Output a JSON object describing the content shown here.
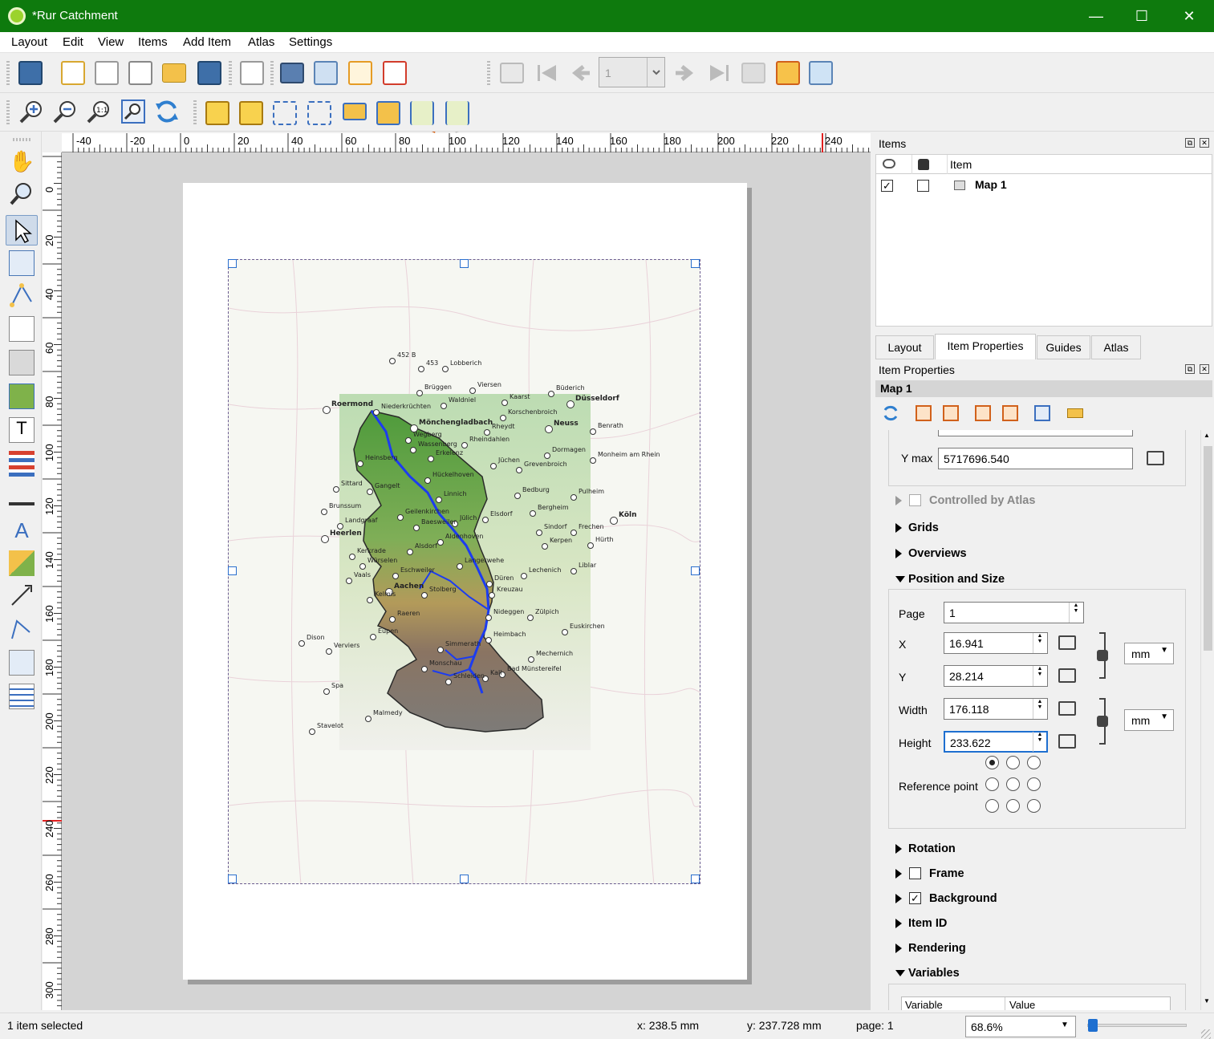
{
  "window": {
    "title": "*Rur Catchment",
    "controls": {
      "minimize": "—",
      "maximize": "☐",
      "close": "✕"
    }
  },
  "menu": [
    "Layout",
    "Edit",
    "View",
    "Items",
    "Add Item",
    "Atlas",
    "Settings"
  ],
  "toolbar": {
    "page_number": "1"
  },
  "ruler": {
    "top_labels": [
      "-40",
      "-20",
      "0",
      "20",
      "40",
      "60",
      "80",
      "100",
      "120",
      "140",
      "160",
      "180",
      "200",
      "220",
      "240"
    ],
    "left_labels": [
      "0",
      "20",
      "40",
      "60",
      "80",
      "100",
      "120",
      "140",
      "160",
      "180",
      "200",
      "220",
      "240",
      "260",
      "280",
      "300"
    ]
  },
  "items_panel": {
    "title": "Items",
    "column_item": "Item",
    "rows": [
      {
        "visible": true,
        "locked": false,
        "name": "Map 1"
      }
    ]
  },
  "tabs": [
    "Layout",
    "Item Properties",
    "Guides",
    "Atlas"
  ],
  "active_tab": "Item Properties",
  "item_properties": {
    "panel_title": "Item Properties",
    "item_name": "Map 1",
    "y_max_label": "Y max",
    "y_max_value": "5717696.540",
    "controlled_by_atlas": "Controlled by Atlas",
    "sections": {
      "grids": "Grids",
      "overviews": "Overviews",
      "position_and_size": "Position and Size",
      "rotation": "Rotation",
      "frame": "Frame",
      "background": "Background",
      "item_id": "Item ID",
      "rendering": "Rendering",
      "variables": "Variables"
    },
    "position": {
      "page_label": "Page",
      "page_value": "1",
      "x_label": "X",
      "x_value": "16.941",
      "y_label": "Y",
      "y_value": "28.214",
      "width_label": "Width",
      "width_value": "176.118",
      "height_label": "Height",
      "height_value": "233.622",
      "unit_position": "mm",
      "unit_size": "mm",
      "reference_point_label": "Reference point"
    },
    "frame_checked": false,
    "background_checked": true,
    "variables_table": {
      "col1": "Variable",
      "col2": "Value"
    }
  },
  "map": {
    "places": [
      {
        "name": "Roermond",
        "bold": true
      },
      {
        "name": "Niederkrüchten"
      },
      {
        "name": "Mönchengladbach",
        "bold": true
      },
      {
        "name": "Düsseldorf",
        "bold": true
      },
      {
        "name": "Neuss",
        "bold": true
      },
      {
        "name": "Heerlen",
        "bold": true
      },
      {
        "name": "Aachen",
        "bold": true
      },
      {
        "name": "Köln",
        "bold": true
      },
      {
        "name": "Jülich"
      },
      {
        "name": "Düren"
      },
      {
        "name": "Monschau"
      },
      {
        "name": "Schleiden"
      },
      {
        "name": "Stolberg"
      },
      {
        "name": "Kerpen"
      },
      {
        "name": "Zülpich"
      },
      {
        "name": "Euskirchen"
      },
      {
        "name": "Malmedy"
      },
      {
        "name": "Linnich"
      },
      {
        "name": "Hückelhoven"
      },
      {
        "name": "Erkelenz"
      },
      {
        "name": "Heinsberg"
      },
      {
        "name": "Geilenkirchen"
      },
      {
        "name": "Eschweiler"
      },
      {
        "name": "Alsdorf"
      },
      {
        "name": "Baesweiler"
      },
      {
        "name": "Langerwehe"
      },
      {
        "name": "Kreuzau"
      },
      {
        "name": "Nideggen"
      },
      {
        "name": "Heimbach"
      },
      {
        "name": "Simmerath"
      },
      {
        "name": "Mechernich"
      },
      {
        "name": "Bad Münstereifel"
      },
      {
        "name": "Kall"
      },
      {
        "name": "Eupen"
      },
      {
        "name": "Raeren"
      },
      {
        "name": "Kelmis"
      },
      {
        "name": "Vaals"
      },
      {
        "name": "Kerkrade"
      },
      {
        "name": "Landgraaf"
      },
      {
        "name": "Brunssum"
      },
      {
        "name": "Sittard"
      },
      {
        "name": "Gangelt"
      },
      {
        "name": "Wegberg"
      },
      {
        "name": "Wassenberg"
      },
      {
        "name": "Rheindahlen"
      },
      {
        "name": "Rheydt"
      },
      {
        "name": "Korschenbroich"
      },
      {
        "name": "Kaarst"
      },
      {
        "name": "Büderich"
      },
      {
        "name": "Viersen"
      },
      {
        "name": "Waldniel"
      },
      {
        "name": "Brüggen"
      },
      {
        "name": "Lobberich"
      },
      {
        "name": "Jüchen"
      },
      {
        "name": "Grevenbroich"
      },
      {
        "name": "Dormagen"
      },
      {
        "name": "Monheim am Rhein"
      },
      {
        "name": "Benrath"
      },
      {
        "name": "Bedburg"
      },
      {
        "name": "Pulheim"
      },
      {
        "name": "Bergheim"
      },
      {
        "name": "Elsdorf"
      },
      {
        "name": "Sindorf"
      },
      {
        "name": "Frechen"
      },
      {
        "name": "Hürth"
      },
      {
        "name": "Lechenich"
      },
      {
        "name": "Liblar"
      },
      {
        "name": "Dison"
      },
      {
        "name": "Verviers"
      },
      {
        "name": "Spa"
      },
      {
        "name": "Stavelot"
      },
      {
        "name": "Aldenhoven"
      },
      {
        "name": "Würselen"
      },
      {
        "name": "452 B"
      },
      {
        "name": "453"
      }
    ]
  },
  "status": {
    "selection": "1 item selected",
    "x": "x: 238.5 mm",
    "y": "y: 237.728 mm",
    "page": "page: 1",
    "zoom": "68.6%"
  }
}
